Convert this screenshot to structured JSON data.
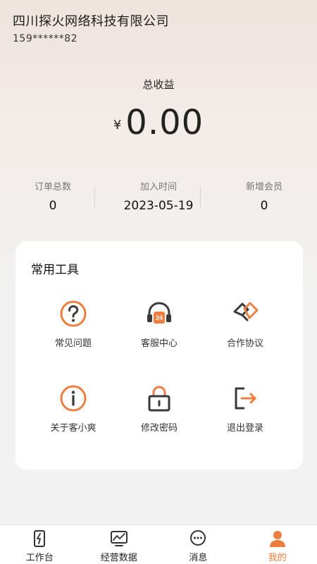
{
  "header": {
    "company_name": "四川探火网络科技有限公司",
    "phone": "159******82"
  },
  "earnings": {
    "label": "总收益",
    "currency_symbol": "¥",
    "amount": "0.00"
  },
  "stats": [
    {
      "label": "订单总数",
      "value": "0"
    },
    {
      "label": "加入时间",
      "value": "2023-05-19"
    },
    {
      "label": "新增会员",
      "value": "0"
    }
  ],
  "tools": {
    "title": "常用工具",
    "items": [
      {
        "label": "常见问题",
        "icon": "question-icon"
      },
      {
        "label": "客服中心",
        "icon": "headset-icon"
      },
      {
        "label": "合作协议",
        "icon": "handshake-icon"
      },
      {
        "label": "关于客小爽",
        "icon": "info-icon"
      },
      {
        "label": "修改密码",
        "icon": "lock-icon"
      },
      {
        "label": "退出登录",
        "icon": "logout-icon"
      }
    ]
  },
  "tabbar": {
    "items": [
      {
        "label": "工作台",
        "icon": "workbench-icon",
        "active": false
      },
      {
        "label": "经营数据",
        "icon": "chart-icon",
        "active": false
      },
      {
        "label": "消息",
        "icon": "message-icon",
        "active": false
      },
      {
        "label": "我的",
        "icon": "user-icon",
        "active": true
      }
    ]
  },
  "colors": {
    "accent": "#ee7e3f",
    "icon_dark": "#3a3a3a"
  }
}
